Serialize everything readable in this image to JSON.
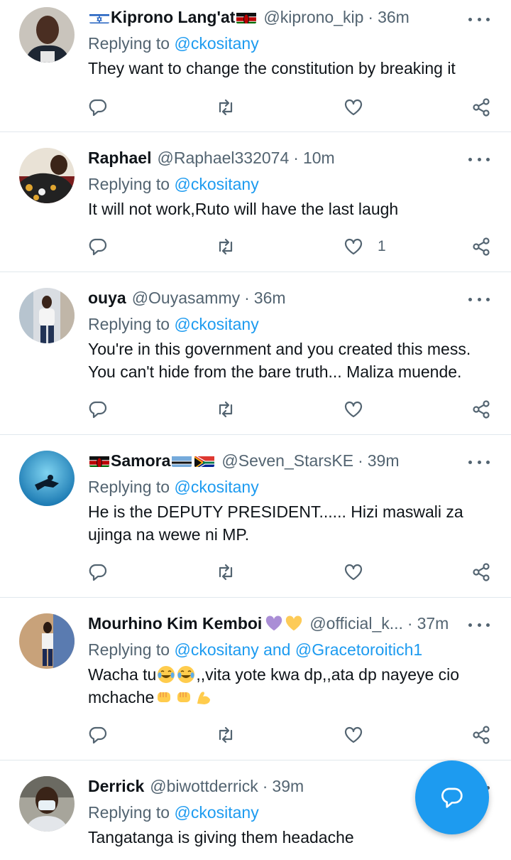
{
  "tweets": [
    {
      "name": "Kiprono Lang'at",
      "handle": "@kiprono_kip",
      "time": "36m",
      "replying_prefix": "Replying to ",
      "replying_to": "@ckositany",
      "text": "They want to change the constitution by breaking it",
      "likes": ""
    },
    {
      "name": "Raphael",
      "handle": "@Raphael332074",
      "time": "10m",
      "replying_prefix": "Replying to ",
      "replying_to": "@ckositany",
      "text": "It will not work,Ruto will have the last laugh",
      "likes": "1"
    },
    {
      "name": "ouya",
      "handle": "@Ouyasammy",
      "time": "36m",
      "replying_prefix": "Replying to ",
      "replying_to": "@ckositany",
      "text": "You're in this government and you created this mess. You can't hide from the bare truth... Maliza muende.",
      "likes": ""
    },
    {
      "name": "Samora",
      "handle": "@Seven_StarsKE",
      "time": "39m",
      "replying_prefix": "Replying to ",
      "replying_to": "@ckositany",
      "text": "He is the DEPUTY PRESIDENT...... Hizi maswali za ujinga na wewe ni MP.",
      "likes": ""
    },
    {
      "name": "Mourhino Kim Kemboi",
      "handle": "@official_k...",
      "time": "37m",
      "replying_prefix": "Replying to ",
      "replying_to": "@ckositany and @Gracetoroitich1",
      "text_part1": "Wacha tu",
      "text_part2": ",,vita yote kwa dp,,ata dp nayeye cio mchache",
      "likes": ""
    },
    {
      "name": "Derrick",
      "handle": "@biwottderrick",
      "time": "39m",
      "replying_prefix": "Replying to ",
      "replying_to": "@ckositany",
      "text": "Tangatanga is giving them headache",
      "likes": ""
    }
  ],
  "icons": {
    "reply": "reply-icon",
    "retweet": "retweet-icon",
    "like": "heart-icon",
    "share": "share-icon",
    "more": "more-icon",
    "compose": "compose-reply-icon"
  },
  "colors": {
    "accent": "#1d9bf0",
    "text": "#0f1419",
    "secondary": "#536471",
    "divider": "#e1e8ed"
  }
}
